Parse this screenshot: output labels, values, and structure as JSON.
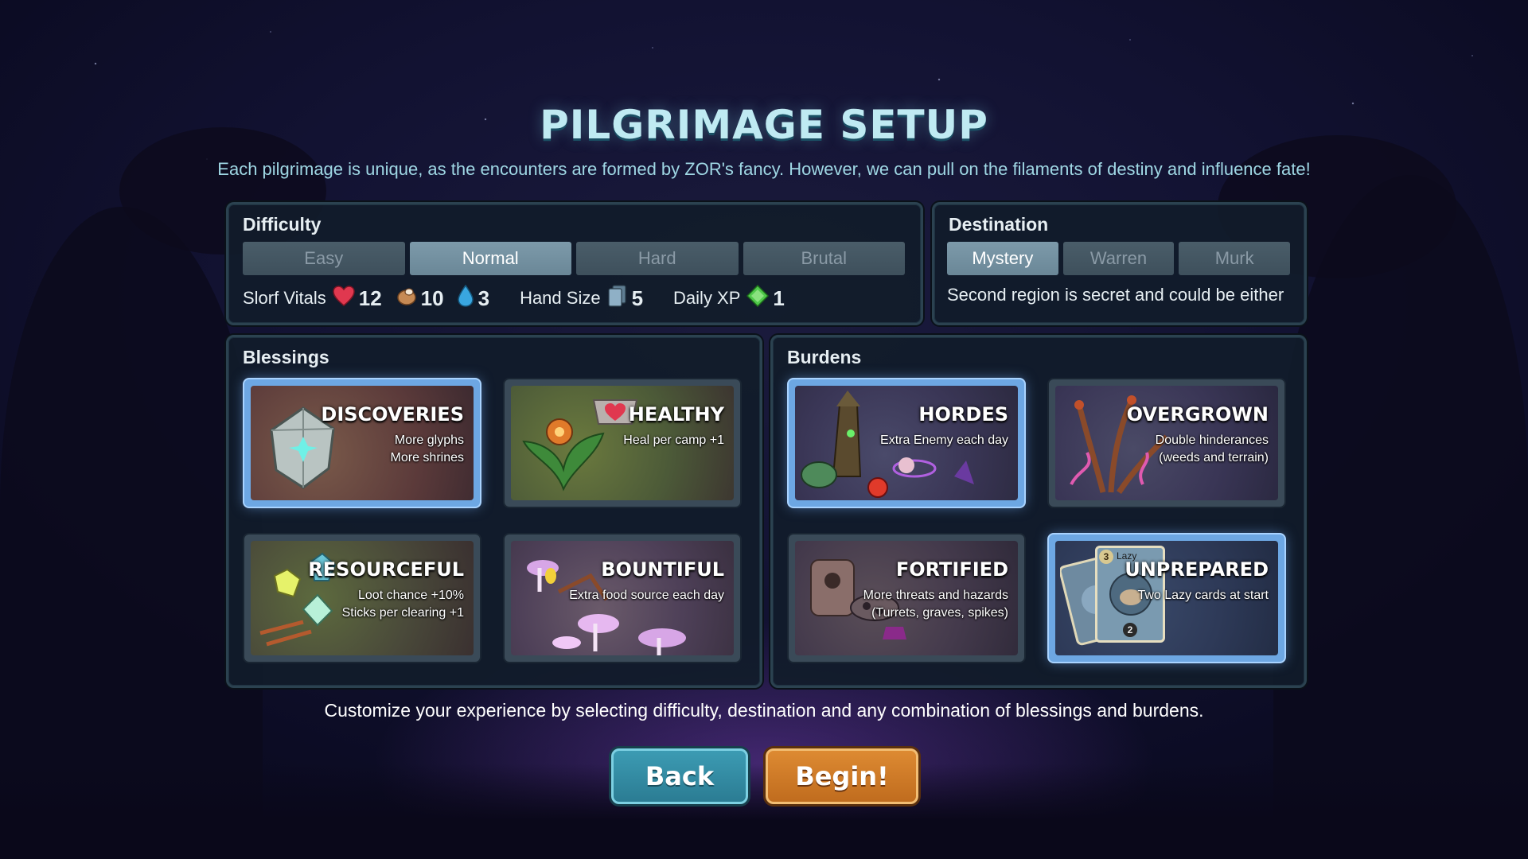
{
  "title": "PILGRIMAGE SETUP",
  "subtitle": "Each pilgrimage is unique, as the encounters are formed by ZOR's fancy. However, we can pull on the filaments of destiny and influence fate!",
  "difficulty": {
    "title": "Difficulty",
    "options": [
      "Easy",
      "Normal",
      "Hard",
      "Brutal"
    ],
    "selected": "Normal",
    "vitals_label": "Slorf Vitals",
    "health": "12",
    "food": "10",
    "water": "3",
    "hand_size_label": "Hand Size",
    "hand_size": "5",
    "daily_xp_label": "Daily XP",
    "daily_xp": "1"
  },
  "destination": {
    "title": "Destination",
    "options": [
      "Mystery",
      "Warren",
      "Murk"
    ],
    "selected": "Mystery",
    "description": "Second region is secret and could be either"
  },
  "blessings": {
    "title": "Blessings",
    "cards": [
      {
        "name": "DISCOVERIES",
        "lines": [
          "More glyphs",
          "More shrines"
        ],
        "selected": true
      },
      {
        "name": "HEALTHY",
        "lines": [
          "Heal per camp +1"
        ],
        "selected": false
      },
      {
        "name": "RESOURCEFUL",
        "lines": [
          "Loot chance +10%",
          "Sticks per clearing +1"
        ],
        "selected": false
      },
      {
        "name": "BOUNTIFUL",
        "lines": [
          "Extra food source each day"
        ],
        "selected": false
      }
    ]
  },
  "burdens": {
    "title": "Burdens",
    "cards": [
      {
        "name": "HORDES",
        "lines": [
          "Extra Enemy each day"
        ],
        "selected": true
      },
      {
        "name": "OVERGROWN",
        "lines": [
          "Double hinderances",
          "(weeds and terrain)"
        ],
        "selected": false
      },
      {
        "name": "FORTIFIED",
        "lines": [
          "More threats and hazards",
          "(Turrets, graves, spikes)"
        ],
        "selected": false
      },
      {
        "name": "UNPREPARED",
        "lines": [
          "Two Lazy cards at start"
        ],
        "selected": true
      }
    ],
    "card_art_labels": {
      "lazy": "Lazy",
      "cost": "3",
      "count": "2"
    }
  },
  "footer": "Customize your experience by selecting difficulty, destination and any combination of blessings and burdens.",
  "buttons": {
    "back": "Back",
    "begin": "Begin!"
  },
  "colors": {
    "accent_title": "#bfeaf2",
    "selected_card": "#6da7e3",
    "back_button": "#2b7c93",
    "begin_button": "#c06c1e"
  }
}
